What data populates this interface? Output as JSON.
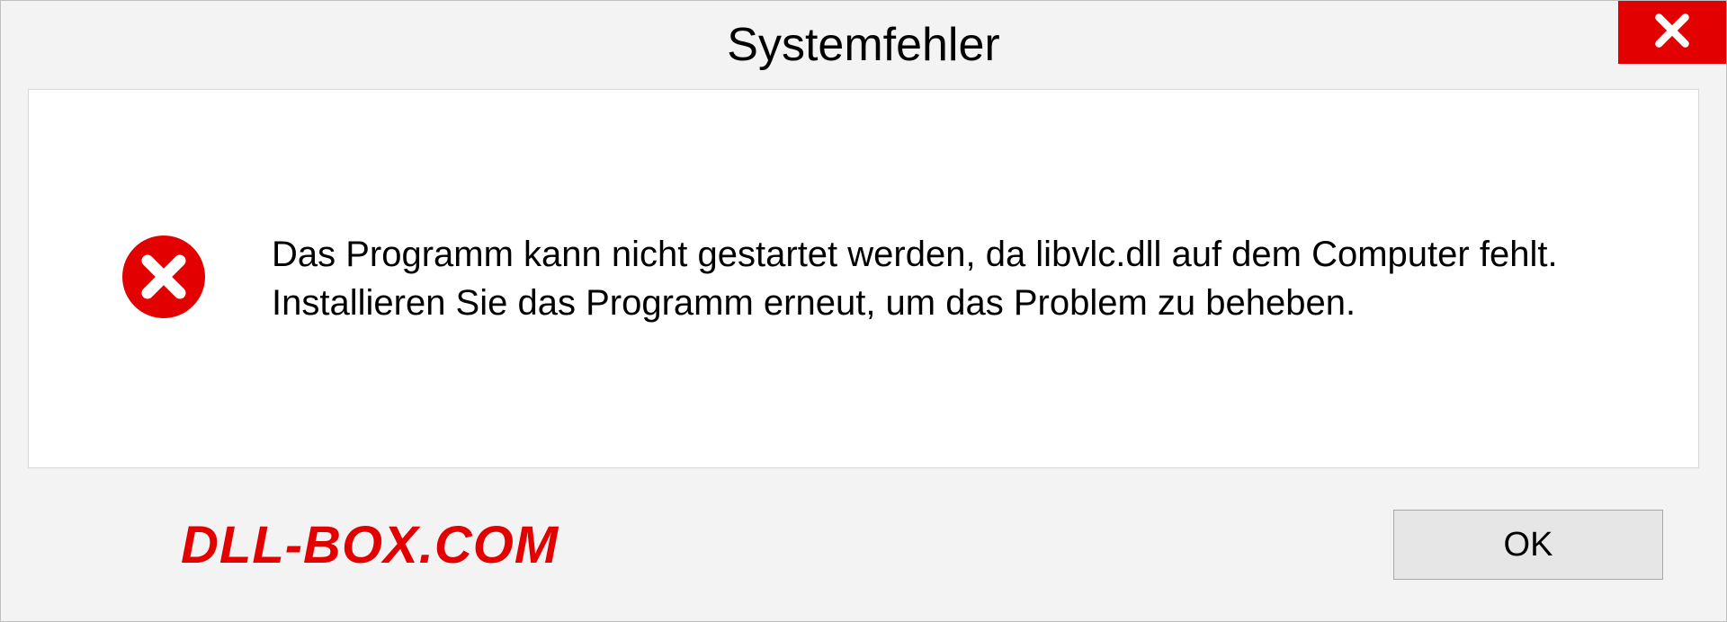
{
  "dialog": {
    "title": "Systemfehler",
    "message": "Das Programm kann nicht gestartet werden, da libvlc.dll auf dem Computer fehlt. Installieren Sie das Programm erneut, um das Problem zu beheben.",
    "ok_label": "OK"
  },
  "watermark": "DLL-BOX.COM",
  "icons": {
    "close": "close-icon",
    "error": "error-icon"
  },
  "colors": {
    "accent_red": "#e20000",
    "panel_bg": "#f3f3f3",
    "content_bg": "#ffffff"
  }
}
